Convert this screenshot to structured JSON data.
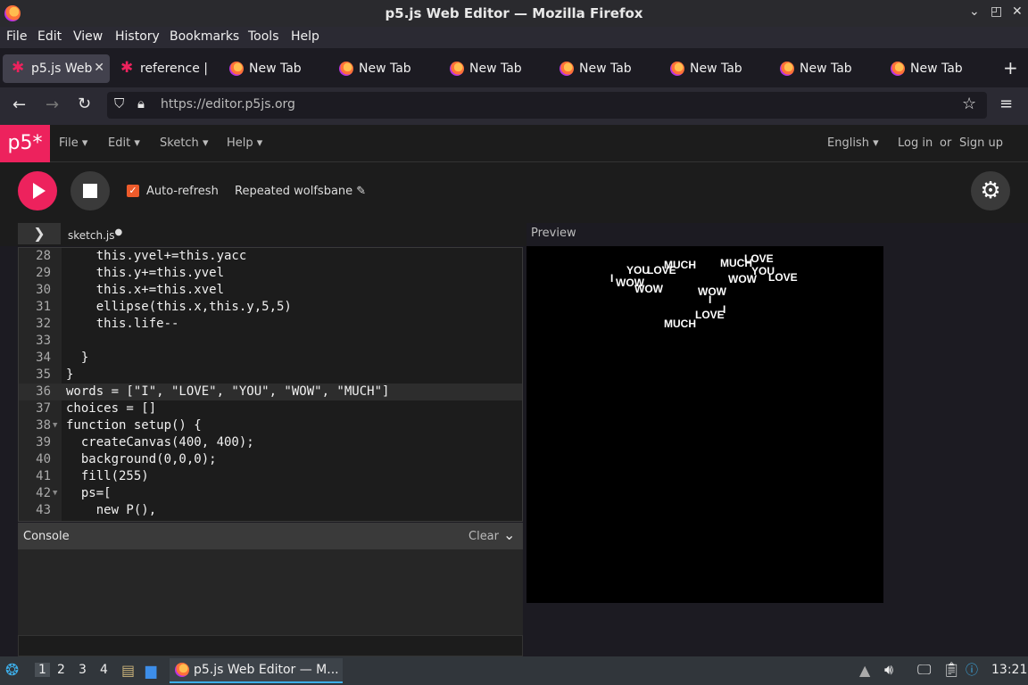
{
  "window": {
    "title": "p5.js Web Editor — Mozilla Firefox"
  },
  "menubar": [
    "File",
    "Edit",
    "View",
    "History",
    "Bookmarks",
    "Tools",
    "Help"
  ],
  "tabs": [
    {
      "label": "p5.js Web",
      "icon": "p5-icon",
      "active": true
    },
    {
      "label": "reference |",
      "icon": "p5-icon"
    },
    {
      "label": "New Tab",
      "icon": "firefox-icon"
    },
    {
      "label": "New Tab",
      "icon": "firefox-icon"
    },
    {
      "label": "New Tab",
      "icon": "firefox-icon"
    },
    {
      "label": "New Tab",
      "icon": "firefox-icon"
    },
    {
      "label": "New Tab",
      "icon": "firefox-icon"
    },
    {
      "label": "New Tab",
      "icon": "firefox-icon"
    },
    {
      "label": "New Tab",
      "icon": "firefox-icon"
    }
  ],
  "nav": {
    "url": "https://editor.p5js.org"
  },
  "p5nav": {
    "logo": "p5*",
    "menus": [
      "File",
      "Edit",
      "Sketch",
      "Help"
    ],
    "language": "English",
    "login": "Log in",
    "or": "or",
    "signup": "Sign up"
  },
  "toolbar": {
    "autorefresh": "Auto-refresh",
    "sketch_name": "Repeated wolfsbane"
  },
  "editor": {
    "filename": "sketch.js",
    "lines": [
      {
        "n": "28",
        "t": "    this.yvel+=this.yacc"
      },
      {
        "n": "29",
        "t": "    this.y+=this.yvel"
      },
      {
        "n": "30",
        "t": "    this.x+=this.xvel"
      },
      {
        "n": "31",
        "t": "    ellipse(this.x,this.y,5,5)"
      },
      {
        "n": "32",
        "t": "    this.life--"
      },
      {
        "n": "33",
        "t": ""
      },
      {
        "n": "34",
        "t": "  }"
      },
      {
        "n": "35",
        "t": "}"
      },
      {
        "n": "36",
        "t": "words = [\"I\", \"LOVE\", \"YOU\", \"WOW\", \"MUCH\"]"
      },
      {
        "n": "37",
        "t": "choices = []"
      },
      {
        "n": "38",
        "t": "function setup() {"
      },
      {
        "n": "39",
        "t": "  createCanvas(400, 400);"
      },
      {
        "n": "40",
        "t": "  background(0,0,0);"
      },
      {
        "n": "41",
        "t": "  fill(255)"
      },
      {
        "n": "42",
        "t": "  ps=["
      },
      {
        "n": "43",
        "t": "    new P(),"
      }
    ]
  },
  "console": {
    "title": "Console",
    "clear": "Clear"
  },
  "preview": {
    "label": "Preview",
    "words": [
      "I",
      "YOU",
      "WOW",
      "LOVE",
      "WOW",
      "MUCH",
      "MUCH",
      "LOVE",
      "YOU",
      "WOW",
      "LOVE",
      "WOW",
      "I",
      "I",
      "LOVE",
      "MUCH"
    ]
  },
  "taskbar": {
    "workspaces": [
      "1",
      "2",
      "3",
      "4"
    ],
    "app": "p5.js Web Editor — M...",
    "clock": "13:21"
  }
}
